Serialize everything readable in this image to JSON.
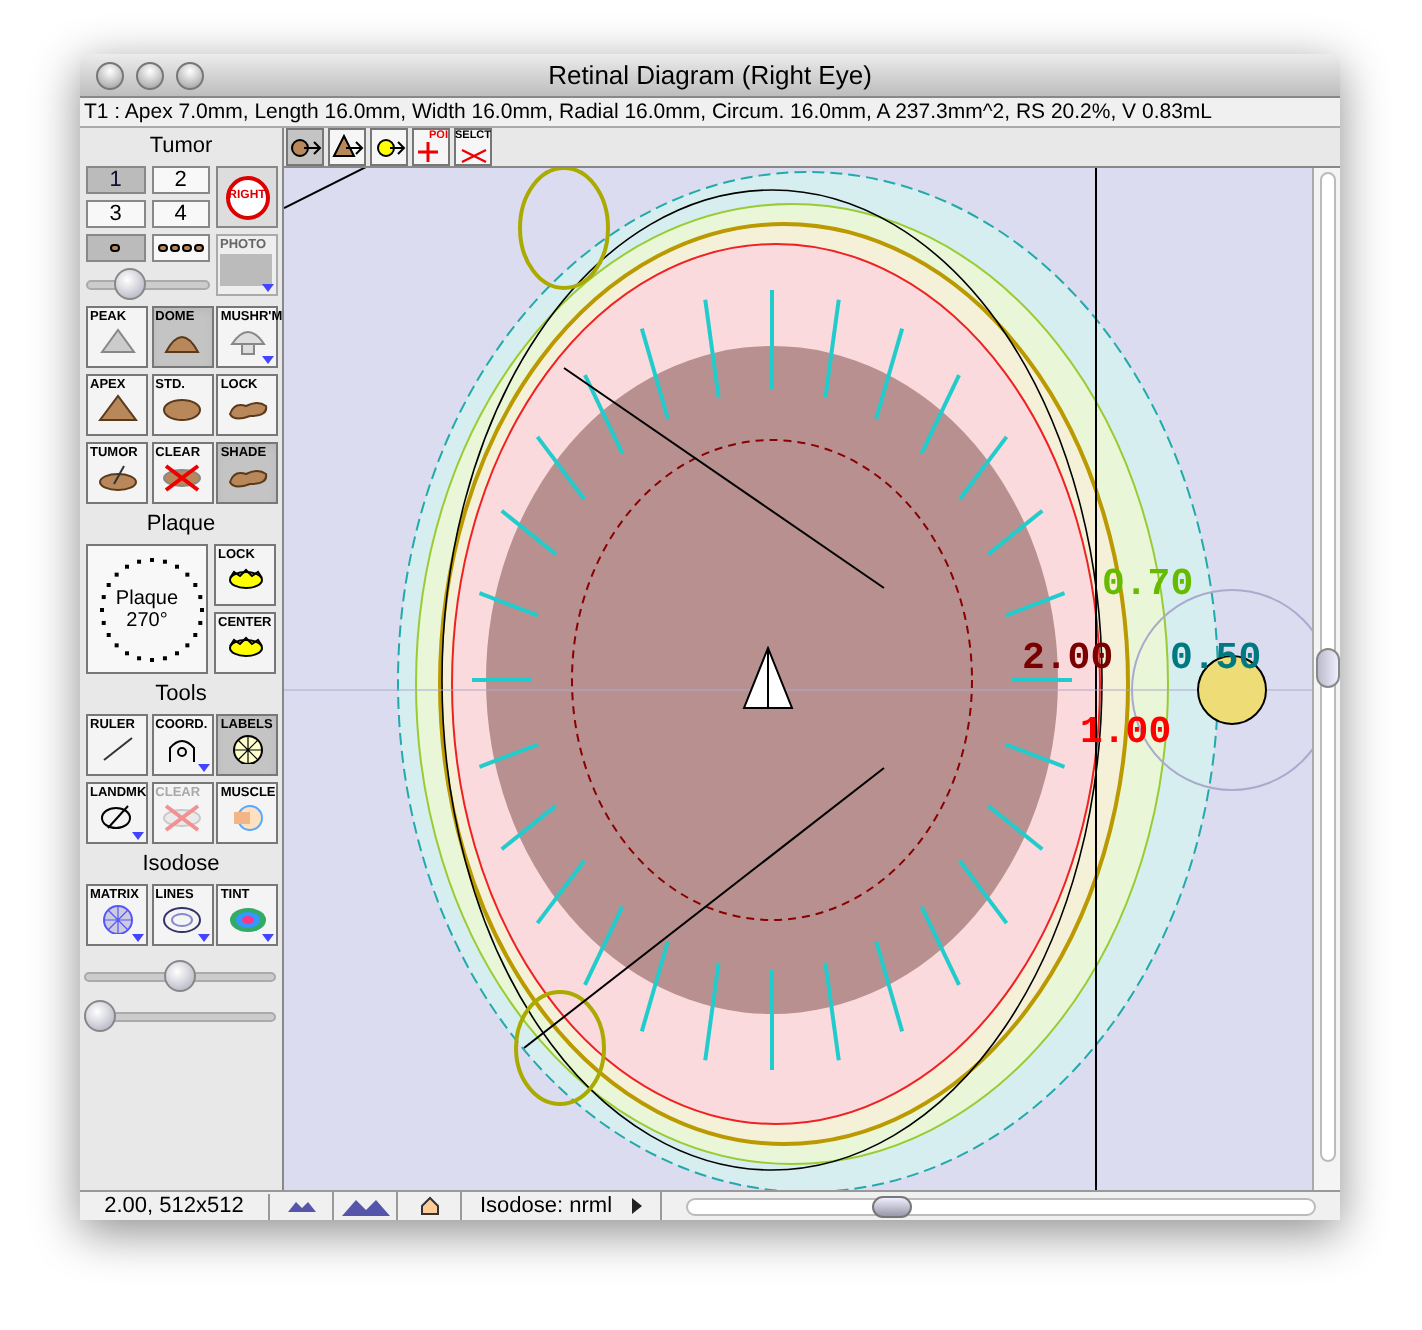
{
  "window": {
    "title": "Retinal Diagram (Right Eye)"
  },
  "info_line": "T1 : Apex 7.0mm, Length 16.0mm, Width 16.0mm, Radial 16.0mm, Circum. 16.0mm, A 237.3mm^2, RS 20.2%, V 0.83mL",
  "toolbar": [
    {
      "kind": "tumor-arrow",
      "selected": true
    },
    {
      "kind": "peak-arrow",
      "selected": false
    },
    {
      "kind": "circle-arrow",
      "selected": false
    },
    {
      "kind": "poi",
      "label": "POI",
      "selected": false
    },
    {
      "kind": "select",
      "label": "SELCT",
      "selected": false
    }
  ],
  "palette": {
    "tumor": {
      "heading": "Tumor",
      "numbers": [
        {
          "label": "1",
          "selected": true
        },
        {
          "label": "2",
          "selected": false
        },
        {
          "label": "3",
          "selected": false
        },
        {
          "label": "4",
          "selected": false
        }
      ],
      "eye_badge": "RIGHT",
      "beads": [
        {
          "kind": "single",
          "selected": true
        },
        {
          "kind": "row",
          "selected": false
        }
      ],
      "photo": {
        "label": "PHOTO",
        "menu": true
      },
      "slider": {
        "level": 0.3
      },
      "shapes": [
        {
          "label": "PEAK",
          "kind": "peak",
          "selected": false,
          "menu": false
        },
        {
          "label": "DOME",
          "kind": "dome",
          "selected": true,
          "menu": false
        },
        {
          "label": "MUSHR'M",
          "kind": "mushroom",
          "selected": false,
          "menu": true
        },
        {
          "label": "APEX",
          "kind": "apex",
          "selected": false,
          "menu": false
        },
        {
          "label": "STD.",
          "kind": "std",
          "selected": false,
          "menu": false
        },
        {
          "label": "LOCK",
          "kind": "lock",
          "selected": false,
          "menu": false
        },
        {
          "label": "TUMOR",
          "kind": "tumor",
          "selected": false,
          "menu": false
        },
        {
          "label": "CLEAR",
          "kind": "clear",
          "selected": false,
          "menu": false
        },
        {
          "label": "SHADE",
          "kind": "lock",
          "selected": true,
          "menu": false
        }
      ]
    },
    "plaque": {
      "heading": "Plaque",
      "dial_label": "Plaque",
      "angle": "270°",
      "buttons": [
        {
          "label": "LOCK",
          "kind": "plaque"
        },
        {
          "label": "CENTER",
          "kind": "plaque"
        }
      ]
    },
    "tools": {
      "heading": "Tools",
      "buttons": [
        {
          "label": "RULER",
          "kind": "ruler",
          "selected": false,
          "disabled": false,
          "menu": false
        },
        {
          "label": "COORD.",
          "kind": "coord",
          "selected": false,
          "disabled": false,
          "menu": true
        },
        {
          "label": "LABELS",
          "kind": "labels",
          "selected": true,
          "disabled": false,
          "menu": false
        },
        {
          "label": "LANDMK",
          "kind": "landmark",
          "selected": false,
          "disabled": false,
          "menu": true
        },
        {
          "label": "CLEAR",
          "kind": "clear",
          "selected": false,
          "disabled": true,
          "menu": false
        },
        {
          "label": "MUSCLE",
          "kind": "muscle",
          "selected": false,
          "disabled": false,
          "menu": false
        }
      ]
    },
    "isodose": {
      "heading": "Isodose",
      "buttons": [
        {
          "label": "MATRIX",
          "kind": "matrix",
          "selected": false,
          "menu": true
        },
        {
          "label": "LINES",
          "kind": "lines",
          "selected": false,
          "menu": true
        },
        {
          "label": "TINT",
          "kind": "tint",
          "selected": false,
          "menu": true
        }
      ],
      "sliders": [
        {
          "level": 0.5
        },
        {
          "level": 0.0
        }
      ]
    }
  },
  "canvas": {
    "isodose_labels": [
      {
        "text": "0.70",
        "color": "#66bb00"
      },
      {
        "text": "2.00",
        "color": "#7a0000"
      },
      {
        "text": "0.50",
        "color": "#007a80"
      },
      {
        "text": "1.00",
        "color": "#ff0000"
      }
    ]
  },
  "status_bar": {
    "zoom": "2.00, 512x512",
    "isodose": "Isodose: nrml"
  }
}
